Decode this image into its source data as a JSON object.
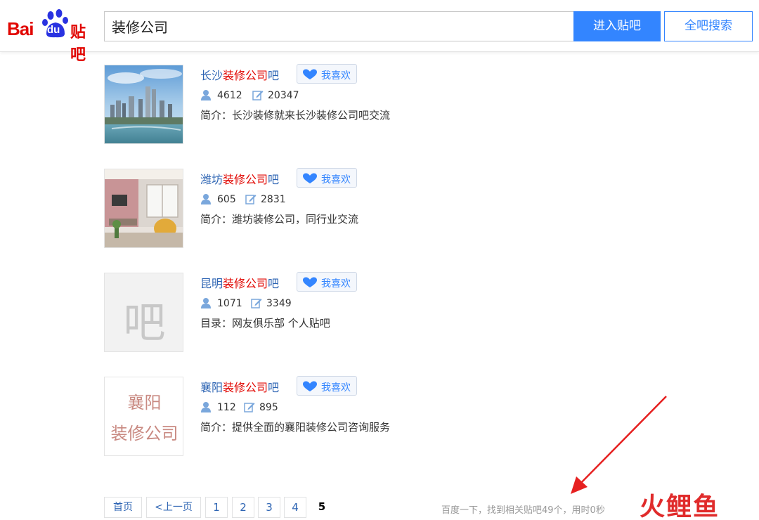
{
  "header": {
    "logo_bai": "Bai",
    "logo_du": "du",
    "logo_tieba": "贴吧",
    "search_value": "装修公司",
    "enter_label": "进入贴吧",
    "search_all_label": "全吧搜索"
  },
  "like_label": "我喜欢",
  "results": [
    {
      "title_pre": "长沙",
      "title_hl": "装修公司",
      "title_post": "吧",
      "members": "4612",
      "posts": "20347",
      "desc": "简介：长沙装修就来长沙装修公司吧交流"
    },
    {
      "title_pre": "潍坊",
      "title_hl": "装修公司",
      "title_post": "吧",
      "members": "605",
      "posts": "2831",
      "desc": "简介：潍坊装修公司，同行业交流"
    },
    {
      "title_pre": "昆明",
      "title_hl": "装修公司",
      "title_post": "吧",
      "members": "1071",
      "posts": "3349",
      "desc": "目录：网友俱乐部  个人贴吧",
      "thumb_text": "吧"
    },
    {
      "title_pre": "襄阳",
      "title_hl": "装修公司",
      "title_post": "吧",
      "members": "112",
      "posts": "895",
      "desc": "简介：提供全面的襄阳装修公司咨询服务",
      "thumb_line1": "襄阳",
      "thumb_line2": "装修公司"
    }
  ],
  "pager": {
    "first": "首页",
    "prev": "<上一页",
    "pages": [
      "1",
      "2",
      "3",
      "4",
      "5"
    ],
    "current": "5"
  },
  "footer_info": "百度一下，找到相关贴吧49个，用时0秒",
  "watermark": "火鲤鱼",
  "colors": {
    "brand_red": "#e10601",
    "link_blue": "#2d64b3",
    "button_blue": "#3385ff"
  }
}
